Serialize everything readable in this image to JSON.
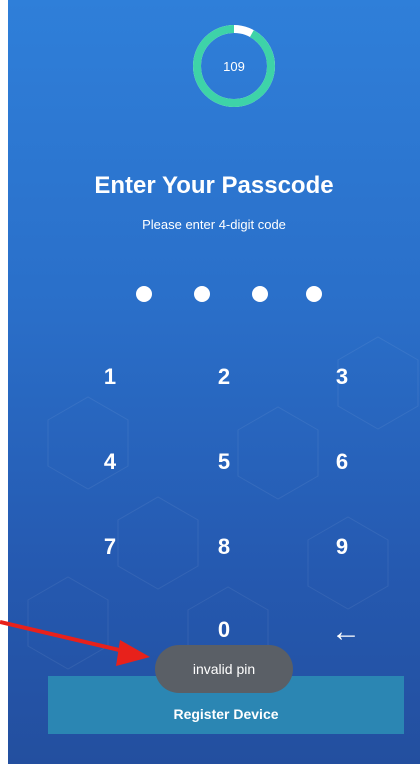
{
  "timer": {
    "value": "109",
    "progress_fraction": 0.92,
    "ring_color": "#3ed3a8",
    "track_color": "#ffffff"
  },
  "header": {
    "title": "Enter Your Passcode",
    "subtitle": "Please enter 4-digit code"
  },
  "pin": {
    "entered_digits": 4,
    "length": 4
  },
  "keypad": {
    "k1": "1",
    "k2": "2",
    "k3": "3",
    "k4": "4",
    "k5": "5",
    "k6": "6",
    "k7": "7",
    "k8": "8",
    "k9": "9",
    "k0": "0",
    "backspace": "←",
    "backspace_icon": "backspace-arrow-icon"
  },
  "toast": {
    "message": "invalid pin"
  },
  "register": {
    "label": "Register Device"
  },
  "colors": {
    "background_top": "#2f7fd9",
    "background_bottom": "#234f9f",
    "button": "#2b86b3",
    "toast": "#5a5f66",
    "annotation_arrow": "#e8211b"
  }
}
